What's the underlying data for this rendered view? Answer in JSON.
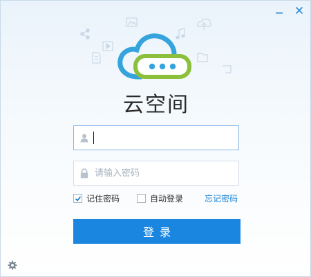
{
  "window": {
    "minimize_icon": "minimize-icon",
    "close_icon": "close-icon"
  },
  "app": {
    "title": "云空间",
    "logo_icon": "cloud-storage-logo"
  },
  "login_form": {
    "username": {
      "value": "",
      "placeholder": "",
      "icon": "user-icon"
    },
    "password": {
      "value": "",
      "placeholder": "请输入密码",
      "icon": "lock-icon"
    },
    "remember_password": {
      "label": "记住密码",
      "checked": true
    },
    "auto_login": {
      "label": "自动登录",
      "checked": false
    },
    "forgot_password_label": "忘记密码",
    "submit_label": "登录"
  },
  "footer": {
    "settings_icon": "gear-icon"
  },
  "colors": {
    "accent": "#1a86e0",
    "logo_blue": "#35a4dc",
    "logo_green": "#8cbf3b",
    "link": "#1a86d8"
  }
}
